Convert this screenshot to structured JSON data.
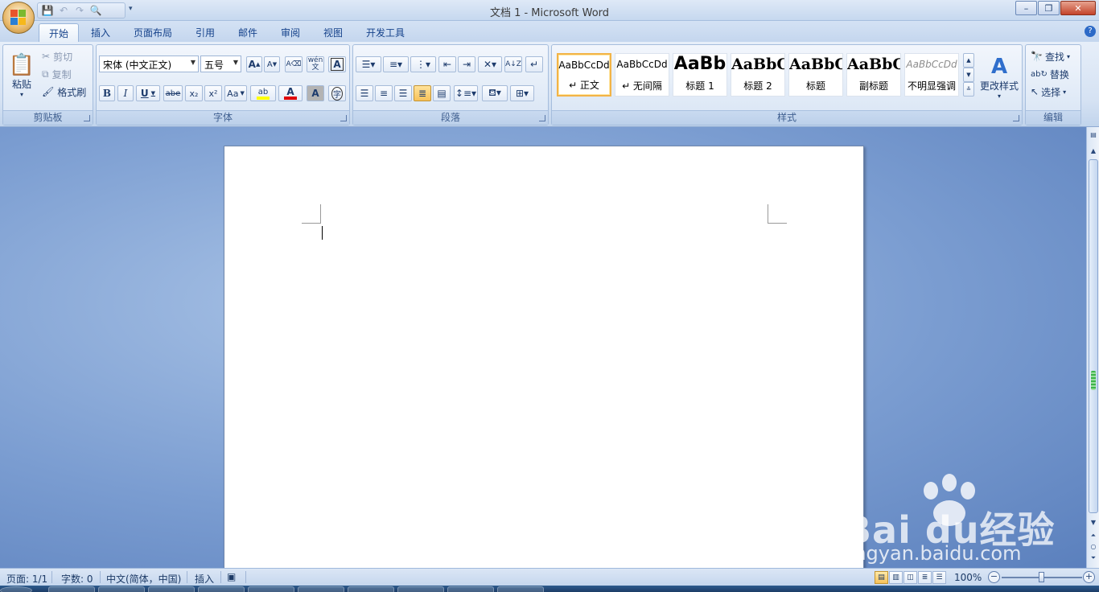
{
  "window": {
    "title": "文档 1 - Microsoft Word",
    "minimize": "–",
    "maximize": "❐",
    "close": "✕"
  },
  "tabs": [
    "开始",
    "插入",
    "页面布局",
    "引用",
    "邮件",
    "审阅",
    "视图",
    "开发工具"
  ],
  "clipboard": {
    "paste": "粘贴",
    "cut": "剪切",
    "copy": "复制",
    "format_painter": "格式刷",
    "label": "剪贴板"
  },
  "font": {
    "name": "宋体 (中文正文)",
    "size": "五号",
    "bold": "B",
    "italic": "I",
    "underline": "U",
    "strike": "abe",
    "subscript": "x₂",
    "superscript": "x²",
    "change_case": "Aa",
    "highlight": "ab",
    "font_color": "A",
    "shading": "A",
    "grow": "A",
    "shrink": "A",
    "clear": "A",
    "phonetic": "wén\n文",
    "border": "A",
    "enclose": "字",
    "label": "字体"
  },
  "paragraph": {
    "label": "段落"
  },
  "styles": {
    "items": [
      {
        "preview": "AaBbCcDd",
        "name": "↵ 正文"
      },
      {
        "preview": "AaBbCcDd",
        "name": "↵ 无间隔"
      },
      {
        "preview": "AaBb",
        "name": "标题 1"
      },
      {
        "preview": "AaBbC",
        "name": "标题 2"
      },
      {
        "preview": "AaBbC",
        "name": "标题"
      },
      {
        "preview": "AaBbC",
        "name": "副标题"
      },
      {
        "preview": "AaBbCcDd",
        "name": "不明显强调"
      }
    ],
    "change_styles": "更改样式",
    "label": "样式"
  },
  "editing": {
    "find": "查找",
    "replace": "替换",
    "select": "选择",
    "label": "编辑"
  },
  "status": {
    "page": "页面: 1/1",
    "words": "字数: 0",
    "language": "中文(简体，中国)",
    "mode": "插入",
    "zoom": "100%",
    "zoom_level": 0.5
  },
  "watermark": {
    "text": "Bai du经验",
    "url": "jingyan.baidu.com"
  },
  "colors": {
    "accent": "#15428b",
    "selected_style_border": "#f2b347",
    "font_color_bar": "#e00000",
    "highlight_bar": "#ffff00"
  }
}
